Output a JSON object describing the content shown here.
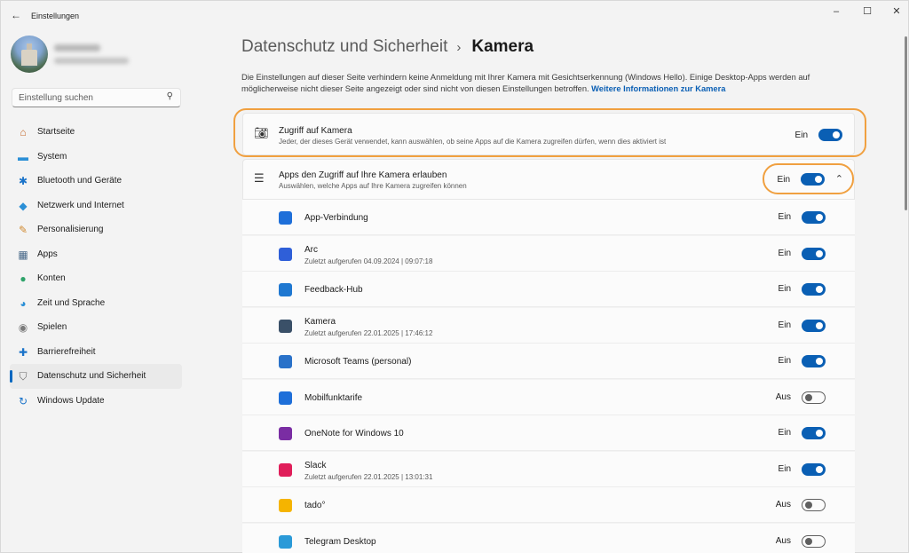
{
  "window": {
    "title": "Einstellungen",
    "controls": [
      "–",
      "☐",
      "✕"
    ]
  },
  "sidebar": {
    "search_placeholder": "Einstellung suchen",
    "items": [
      {
        "label": "Startseite",
        "icon": "home-icon",
        "glyph": "⌂",
        "color": "#c46a2c"
      },
      {
        "label": "System",
        "icon": "monitor-icon",
        "glyph": "▬",
        "color": "#2b8fd6"
      },
      {
        "label": "Bluetooth und Geräte",
        "icon": "bluetooth-icon",
        "glyph": "✱",
        "color": "#1a73c9"
      },
      {
        "label": "Netzwerk und Internet",
        "icon": "wifi-icon",
        "glyph": "◆",
        "color": "#2b8fd6"
      },
      {
        "label": "Personalisierung",
        "icon": "brush-icon",
        "glyph": "✎",
        "color": "#d08a30"
      },
      {
        "label": "Apps",
        "icon": "apps-icon",
        "glyph": "▦",
        "color": "#4a6a8a"
      },
      {
        "label": "Konten",
        "icon": "person-icon",
        "glyph": "●",
        "color": "#2ea36a"
      },
      {
        "label": "Zeit und Sprache",
        "icon": "clock-globe-icon",
        "glyph": "◕",
        "color": "#2b8fd6"
      },
      {
        "label": "Spielen",
        "icon": "gamepad-icon",
        "glyph": "◉",
        "color": "#7a7a7a"
      },
      {
        "label": "Barrierefreiheit",
        "icon": "accessibility-icon",
        "glyph": "✚",
        "color": "#1a73c9"
      },
      {
        "label": "Datenschutz und Sicherheit",
        "icon": "shield-icon",
        "glyph": "⛉",
        "color": "#6a6a6a",
        "active": true
      },
      {
        "label": "Windows Update",
        "icon": "update-icon",
        "glyph": "↻",
        "color": "#1a73c9"
      }
    ]
  },
  "main": {
    "breadcrumb_parent": "Datenschutz und Sicherheit",
    "breadcrumb_sep": "›",
    "breadcrumb_current": "Kamera",
    "description": "Die Einstellungen auf dieser Seite verhindern keine Anmeldung mit Ihrer Kamera mit Gesichtserkennung (Windows Hello). Einige Desktop-Apps werden auf möglicherweise nicht dieser Seite angezeigt oder sind nicht von diesen Einstellungen betroffen.",
    "more_info_link": "Weitere Informationen zur Kamera",
    "access_card": {
      "title": "Zugriff auf Kamera",
      "subtitle": "Jeder, der dieses Gerät verwendet, kann auswählen, ob seine Apps auf die Kamera zugreifen dürfen, wenn dies aktiviert ist",
      "state": "Ein",
      "on": true
    },
    "apps_card": {
      "title": "Apps den Zugriff auf Ihre Kamera erlauben",
      "subtitle": "Auswählen, welche Apps auf Ihre Kamera zugreifen können",
      "state": "Ein",
      "on": true
    },
    "apps": [
      {
        "name": "App-Verbindung",
        "sub": "",
        "state": "Ein",
        "on": true,
        "icon": "app-connector-icon",
        "color": "#1e6fd9"
      },
      {
        "name": "Arc",
        "sub": "Zuletzt aufgerufen 04.09.2024  |  09:07:18",
        "state": "Ein",
        "on": true,
        "icon": "arc-icon",
        "color": "#2f5fd8"
      },
      {
        "name": "Feedback-Hub",
        "sub": "",
        "state": "Ein",
        "on": true,
        "icon": "feedback-hub-icon",
        "color": "#1f78d1"
      },
      {
        "name": "Kamera",
        "sub": "Zuletzt aufgerufen 22.01.2025  |  17:46:12",
        "state": "Ein",
        "on": true,
        "icon": "camera-app-icon",
        "color": "#3a5068"
      },
      {
        "name": "Microsoft Teams (personal)",
        "sub": "",
        "state": "Ein",
        "on": true,
        "icon": "teams-icon",
        "color": "#2a72c9"
      },
      {
        "name": "Mobilfunktarife",
        "sub": "",
        "state": "Aus",
        "on": false,
        "icon": "mobile-plans-icon",
        "color": "#1e6fd9"
      },
      {
        "name": "OneNote for Windows 10",
        "sub": "",
        "state": "Ein",
        "on": true,
        "icon": "onenote-icon",
        "color": "#7a2da3"
      },
      {
        "name": "Slack",
        "sub": "Zuletzt aufgerufen 22.01.2025  |  13:01:31",
        "state": "Ein",
        "on": true,
        "icon": "slack-icon",
        "color": "#e01e5a"
      },
      {
        "name": "tado°",
        "sub": "",
        "state": "Aus",
        "on": false,
        "icon": "tado-icon",
        "color": "#f5b400"
      },
      {
        "name": "Telegram Desktop",
        "sub": "",
        "state": "Aus",
        "on": false,
        "icon": "telegram-icon",
        "color": "#2a9ad8"
      }
    ]
  },
  "colors": {
    "accent": "#0a5fb4",
    "highlight": "#f0a040"
  }
}
